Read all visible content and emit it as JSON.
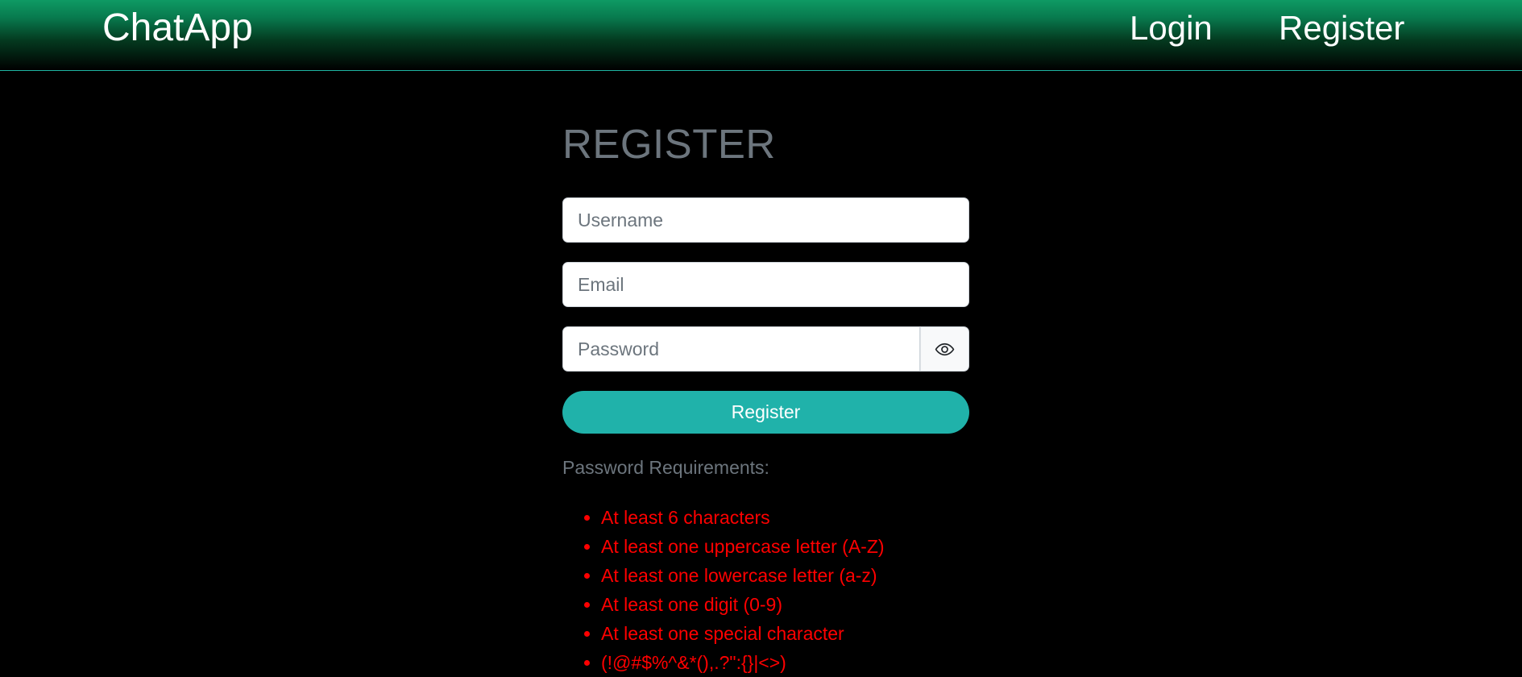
{
  "navbar": {
    "brand": "ChatApp",
    "links": [
      {
        "label": "Login"
      },
      {
        "label": "Register"
      }
    ]
  },
  "form": {
    "title": "REGISTER",
    "username": {
      "placeholder": "Username",
      "value": ""
    },
    "email": {
      "placeholder": "Email",
      "value": ""
    },
    "password": {
      "placeholder": "Password",
      "value": "",
      "toggle_icon": "eye-icon"
    },
    "submit_label": "Register"
  },
  "requirements": {
    "title": "Password Requirements:",
    "items": [
      "At least 6 characters",
      "At least one uppercase letter (A-Z)",
      "At least one lowercase letter (a-z)",
      "At least one digit (0-9)",
      "At least one special character",
      "(!@#$%^&*(),.?\":{}|<>)"
    ],
    "status_color": "#ff0000"
  },
  "colors": {
    "accent": "#20b2aa",
    "header_green": "#0e9a64",
    "muted_text": "#6c757d"
  }
}
